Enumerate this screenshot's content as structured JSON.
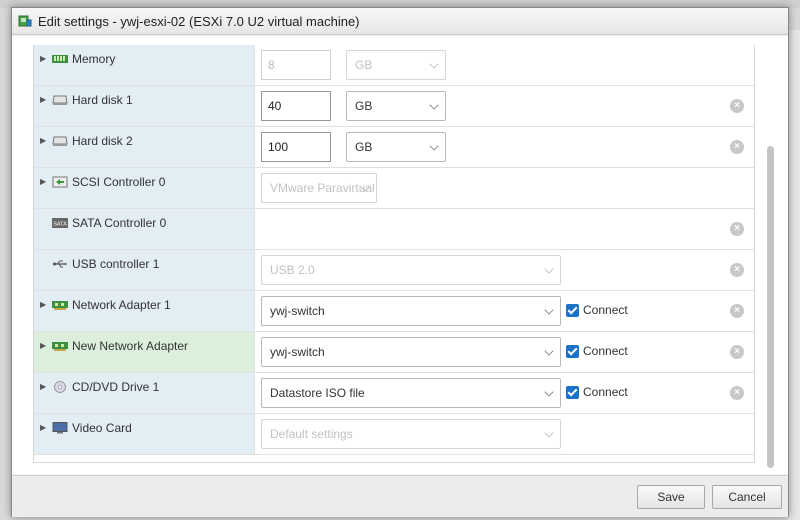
{
  "dialog": {
    "title": "Edit settings - ywj-esxi-02 (ESXi 7.0 U2 virtual machine)"
  },
  "rows": [
    {
      "label": "Memory",
      "value": "8",
      "unit": "GB"
    },
    {
      "label": "Hard disk 1",
      "value": "40",
      "unit": "GB"
    },
    {
      "label": "Hard disk 2",
      "value": "100",
      "unit": "GB"
    },
    {
      "label": "SCSI Controller 0",
      "select": "VMware Paravirtual"
    },
    {
      "label": "SATA Controller 0"
    },
    {
      "label": "USB controller 1",
      "select": "USB 2.0"
    },
    {
      "label": "Network Adapter 1",
      "select": "ywj-switch",
      "connect": "Connect"
    },
    {
      "label": "New Network Adapter",
      "select": "ywj-switch",
      "connect": "Connect"
    },
    {
      "label": "CD/DVD Drive 1",
      "select": "Datastore ISO file",
      "connect": "Connect"
    },
    {
      "label": "Video Card",
      "select": "Default settings"
    }
  ],
  "footer": {
    "save": "Save",
    "cancel": "Cancel"
  },
  "icons": {
    "remove": "×",
    "caret": "▶"
  }
}
